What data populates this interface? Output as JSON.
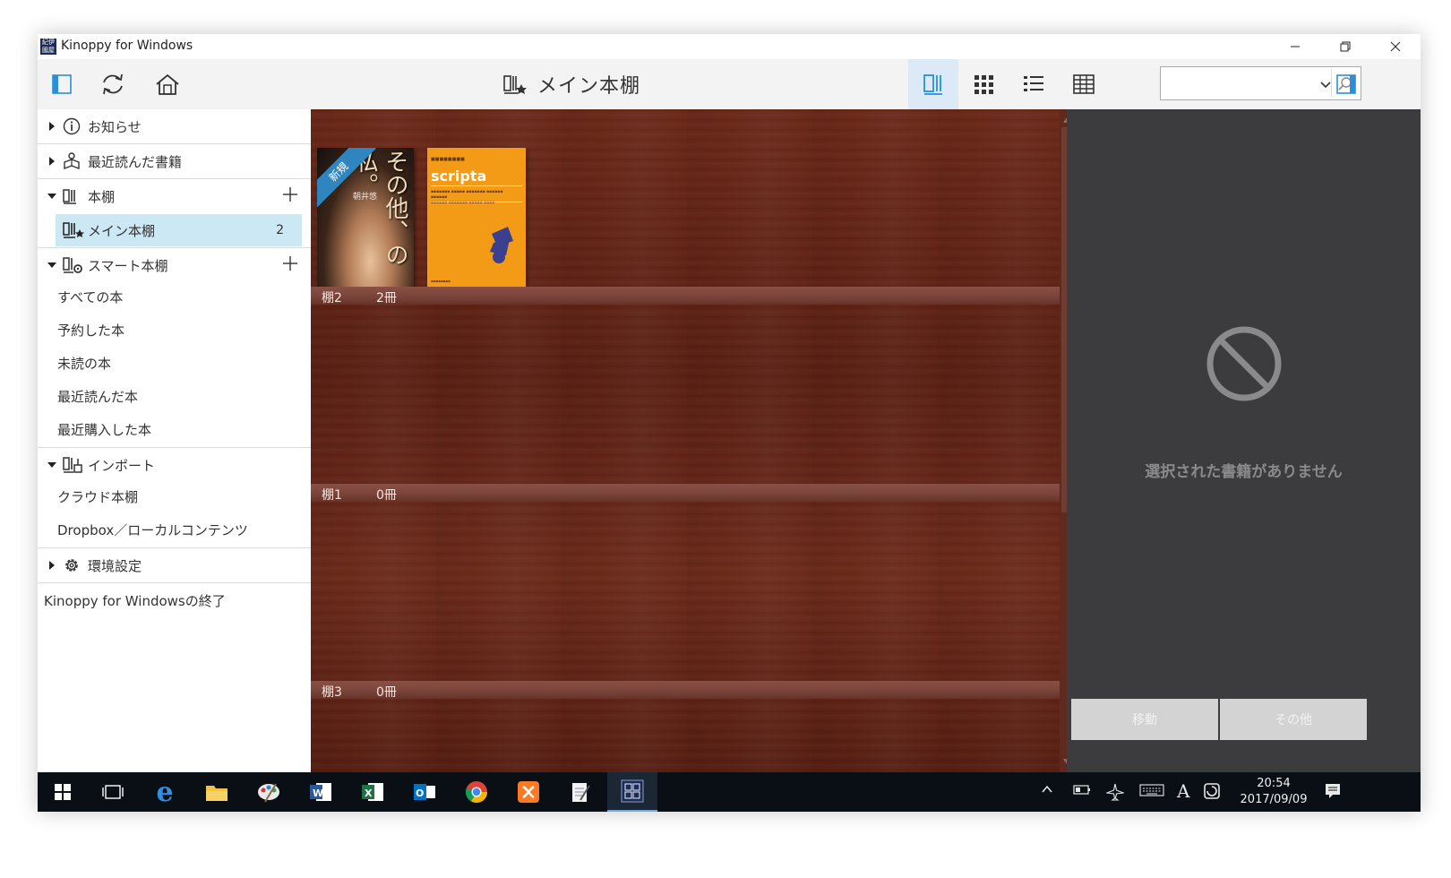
{
  "window": {
    "title": "Kinoppy for Windows",
    "app_icon_text": "紀伊 國屋"
  },
  "toolbar": {
    "title": "メイン本棚",
    "search": {
      "value": "",
      "placeholder": ""
    },
    "view_modes": [
      "shelf-view",
      "grid-view",
      "list-view",
      "table-view"
    ],
    "active_view": "shelf-view"
  },
  "sidebar": {
    "notice": "お知らせ",
    "recent_books": "最近読んだ書籍",
    "bookshelf": {
      "label": "本棚",
      "items": [
        {
          "label": "メイン本棚",
          "count": "2"
        }
      ]
    },
    "smart_shelf": {
      "label": "スマート本棚",
      "items": [
        "すべての本",
        "予約した本",
        "未読の本",
        "最近読んだ本",
        "最近購入した本"
      ]
    },
    "import": {
      "label": "インポート",
      "items": [
        "クラウド本棚",
        "Dropbox／ローカルコンテンツ"
      ]
    },
    "settings": "環境設定",
    "exit": "Kinoppy for Windowsの終了"
  },
  "shelves": [
    {
      "name": "棚2",
      "count": "2冊"
    },
    {
      "name": "棚1",
      "count": "0冊"
    },
    {
      "name": "棚3",
      "count": "0冊"
    }
  ],
  "books": [
    {
      "title": "その他、の私。",
      "author": "朝井悠",
      "badge": "新規",
      "cover_color": "#2a1a14"
    },
    {
      "title": "scripta",
      "cover_color": "#f39a16"
    }
  ],
  "detail": {
    "empty_message": "選択された書籍がありません",
    "move_button": "移動",
    "other_button": "その他"
  },
  "taskbar": {
    "time": "20:54",
    "date": "2017/09/09",
    "ime": "A",
    "apps": [
      "start",
      "task-view",
      "edge",
      "file-explorer",
      "paint",
      "word",
      "excel",
      "outlook",
      "chrome",
      "xampp",
      "notepad",
      "kinoppy"
    ]
  },
  "colors": {
    "accent": "#2b8fd6",
    "selection": "#cce8f4",
    "shelf_wood": "#5e2214",
    "detail_bg": "#3c3c3e",
    "taskbar_bg": "#0a0f16"
  }
}
